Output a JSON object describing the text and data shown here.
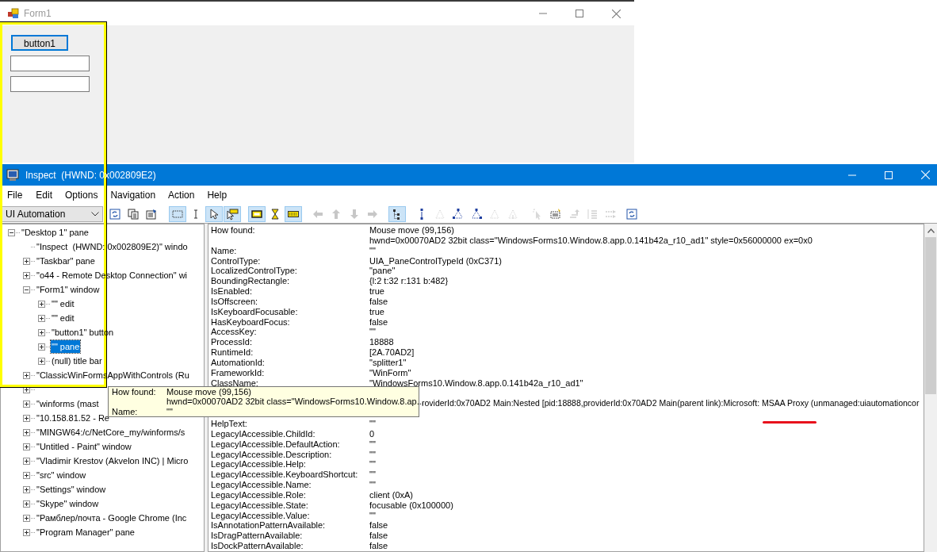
{
  "form_window": {
    "title": "Form1",
    "button": "button1"
  },
  "inspect_window": {
    "title": "Inspect  (HWND: 0x002809E2)",
    "menu": [
      "File",
      "Edit",
      "Options",
      "Navigation",
      "Action",
      "Help"
    ],
    "mode_dropdown": {
      "value": "UI Automation"
    },
    "toolbar": [
      {
        "selected": false,
        "disabled": false
      },
      {
        "selected": false,
        "disabled": false
      },
      {
        "selected": false,
        "disabled": false
      },
      {
        "selected": true,
        "disabled": false
      },
      {
        "selected": false,
        "disabled": false
      },
      {
        "selected": true,
        "disabled": false
      },
      {
        "selected": true,
        "disabled": false
      },
      {
        "selected": true,
        "disabled": false
      },
      {
        "selected": false,
        "disabled": false
      },
      {
        "selected": true,
        "disabled": false
      },
      {
        "selected": false,
        "disabled": true
      },
      {
        "selected": false,
        "disabled": true
      },
      {
        "selected": false,
        "disabled": true
      },
      {
        "selected": false,
        "disabled": true
      },
      {
        "selected": true,
        "disabled": false
      },
      {
        "selected": false,
        "disabled": false
      },
      {
        "selected": false,
        "disabled": true
      },
      {
        "selected": false,
        "disabled": false
      },
      {
        "selected": false,
        "disabled": false
      },
      {
        "selected": false,
        "disabled": true
      },
      {
        "selected": false,
        "disabled": true
      },
      {
        "selected": false,
        "disabled": true
      },
      {
        "selected": false,
        "disabled": false
      },
      {
        "selected": false,
        "disabled": true
      },
      {
        "selected": false,
        "disabled": true
      },
      {
        "selected": false,
        "disabled": true
      },
      {
        "selected": false,
        "disabled": false
      }
    ],
    "tree": [
      {
        "label": "\"Desktop 1\" pane",
        "expanded": true,
        "selected": false,
        "children": [
          {
            "label": "\"Inspect  (HWND: 0x002809E2)\" windo",
            "selected": false
          },
          {
            "label": "\"Taskbar\" pane",
            "expanded": false,
            "selected": false
          },
          {
            "label": "\"o44 - Remote Desktop Connection\" wi",
            "expanded": false,
            "selected": false
          },
          {
            "label": "\"Form1\" window",
            "expanded": true,
            "selected": false,
            "children": [
              {
                "label": "\"\" edit",
                "expanded": false,
                "selected": false
              },
              {
                "label": "\"\" edit",
                "expanded": false,
                "selected": false
              },
              {
                "label": "\"button1\" button",
                "expanded": false,
                "selected": false
              },
              {
                "label": "\"\" pane",
                "expanded": false,
                "selected": true
              },
              {
                "label": "(null) title bar",
                "expanded": false,
                "selected": false
              }
            ]
          },
          {
            "label": "\"ClassicWinFormsAppWithControls (Ru",
            "expanded": false,
            "selected": false
          },
          {
            "expanded": false,
            "selected": false
          },
          {
            "label": "\"winforms (mast",
            "expanded": false,
            "selected": false
          },
          {
            "label": "\"10.158.81.52 - Re",
            "expanded": false,
            "selected": false
          },
          {
            "label": "\"MINGW64:/c/NetCore_my/winforms/s",
            "expanded": false,
            "selected": false
          },
          {
            "label": "\"Untitled - Paint\" window",
            "expanded": false,
            "selected": false
          },
          {
            "label": "\"Vladimir Krestov (Akvelon INC) | Micro",
            "expanded": false,
            "selected": false
          },
          {
            "label": "\"src\" window",
            "expanded": false,
            "selected": false
          },
          {
            "label": "\"Settings\" window",
            "expanded": false,
            "selected": false
          },
          {
            "label": "\"Skype\" window",
            "expanded": false,
            "selected": false
          },
          {
            "label": "\"Рамблер/почта - Google Chrome (Inc",
            "expanded": false,
            "selected": false
          },
          {
            "label": "\"Program Manager\" pane",
            "expanded": false,
            "selected": false
          }
        ]
      }
    ],
    "properties": [
      {
        "label": "How found:",
        "value": "Mouse move (99,156)"
      },
      {
        "value": "hwnd=0x00070AD2 32bit class=\"WindowsForms10.Window.8.app.0.141b42a_r10_ad1\" style=0x56000000 ex=0x0"
      },
      {
        "label": "Name:",
        "value": "\"\""
      },
      {
        "label": "ControlType:",
        "value": "UIA_PaneControlTypeId (0xC371)"
      },
      {
        "label": "LocalizedControlType:",
        "value": "\"pane\""
      },
      {
        "label": "BoundingRectangle:",
        "value": "{l:2 t:32 r:131 b:482}"
      },
      {
        "label": "IsEnabled:",
        "value": "true"
      },
      {
        "label": "IsOffscreen:",
        "value": "false"
      },
      {
        "label": "IsKeyboardFocusable:",
        "value": "true"
      },
      {
        "label": "HasKeyboardFocus:",
        "value": "false"
      },
      {
        "label": "AccessKey:",
        "value": "\"\""
      },
      {
        "label": "ProcessId:",
        "value": "18888"
      },
      {
        "label": "RuntimeId:",
        "value": "[2A.70AD2]"
      },
      {
        "label": "AutomationId:",
        "value": "\"splitter1\""
      },
      {
        "label": "FrameworkId:",
        "value": "\"WinForm\""
      },
      {
        "label": "ClassName:",
        "value": "\"WindowsForms10.Window.8.app.0.141b42a_r10_ad1\""
      },
      {
        "kind": "covered"
      },
      {
        "kind": "clipped",
        "value": "roviderId:0x70AD2 Main:Nested [pid:18888,providerId:0x70AD2 Main(parent link):Microsoft: MSAA Proxy (unmanaged:uiautomationcor"
      },
      {
        "kind": "covered"
      },
      {
        "label": "HelpText:",
        "value": "\"\""
      },
      {
        "label": "LegacyIAccessible.ChildId:",
        "value": "0"
      },
      {
        "label": "LegacyIAccessible.DefaultAction:",
        "value": "\"\""
      },
      {
        "label": "LegacyIAccessible.Description:",
        "value": "\"\""
      },
      {
        "label": "LegacyIAccessible.Help:",
        "value": "\"\""
      },
      {
        "label": "LegacyIAccessible.KeyboardShortcut:",
        "value": "\"\""
      },
      {
        "label": "LegacyIAccessible.Name:",
        "value": "\"\""
      },
      {
        "label": "LegacyIAccessible.Role:",
        "value": "client (0xA)"
      },
      {
        "label": "LegacyIAccessible.State:",
        "value": "focusable (0x100000)"
      },
      {
        "label": "LegacyIAccessible.Value:",
        "value": "\"\""
      },
      {
        "label": "IsAnnotationPatternAvailable:",
        "value": "false"
      },
      {
        "label": "IsDragPatternAvailable:",
        "value": "false"
      },
      {
        "label": "IsDockPatternAvailable:",
        "value": "false"
      }
    ],
    "tooltip": [
      {
        "label": "How found:",
        "value": "Mouse move (99,156)"
      },
      {
        "value": "hwnd=0x00070AD2 32bit class=\"WindowsForms10.Window.8.ap..."
      },
      {
        "label": "Name:",
        "value": "\"\""
      }
    ]
  }
}
